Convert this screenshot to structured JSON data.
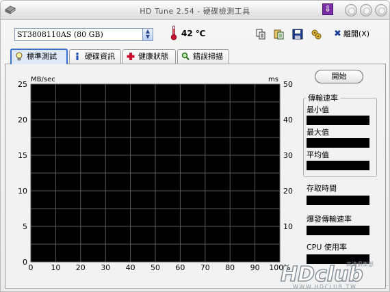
{
  "window": {
    "title": "HD Tune 2.54 - 硬碟檢測工具"
  },
  "toolbar": {
    "drive": "ST3808110AS (80 GB)",
    "temperature": "42 ℃",
    "exit_label": "離開(X)"
  },
  "tabs": [
    {
      "label": "標準測試",
      "icon": "lightbulb-icon",
      "active": true
    },
    {
      "label": "硬碟資訊",
      "icon": "info-icon",
      "active": false
    },
    {
      "label": "健康狀態",
      "icon": "plus-icon",
      "active": false
    },
    {
      "label": "錯誤掃描",
      "icon": "magnifier-icon",
      "active": false
    }
  ],
  "chart_data": {
    "type": "line",
    "title": "",
    "ylabel_left": "MB/sec",
    "ylabel_right": "ms",
    "yticks_left": [
      "25",
      "20",
      "15",
      "10",
      "5",
      "0"
    ],
    "yticks_right": [
      "50",
      "40",
      "30",
      "20",
      "10"
    ],
    "xticks": [
      "0",
      "10",
      "20",
      "30",
      "40",
      "50",
      "60",
      "70",
      "80",
      "90",
      "100%"
    ],
    "ylim_left": [
      0,
      25
    ],
    "ylim_right": [
      0,
      50
    ],
    "xlim": [
      0,
      100
    ],
    "grid": true,
    "background": "#000000",
    "grid_color": "#5a5a5a",
    "series": []
  },
  "panel": {
    "start_button": "開始",
    "transfer_group_title": "傳輸速率",
    "min_label": "最小值",
    "max_label": "最大值",
    "avg_label": "平均值",
    "access_time_label": "存取時間",
    "burst_rate_label": "爆發傳輸速率",
    "cpu_usage_label": "CPU 使用率"
  },
  "watermark": {
    "brand": "HDclub",
    "url": "WWW.HDCLUB.TW",
    "subtitle": "高清俱樂部"
  },
  "colors": {
    "accent": "#3a6fd2",
    "thermo": "#c8102e",
    "watermark": "#9aa0a8"
  }
}
